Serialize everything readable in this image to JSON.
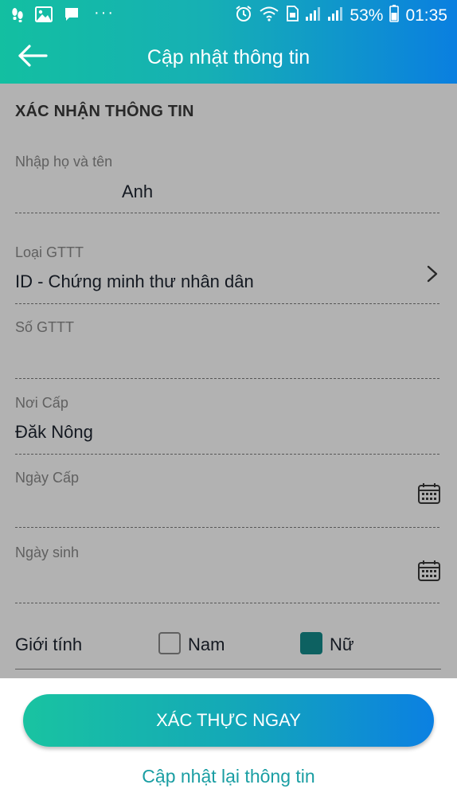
{
  "status_bar": {
    "battery_percent": "53%",
    "time": "01:35",
    "more_dots": "···"
  },
  "app_bar": {
    "title": "Cập nhật thông tin",
    "back_icon": "arrow-left-icon"
  },
  "form": {
    "section_title": "XÁC NHẬN THÔNG TIN",
    "full_name": {
      "label": "Nhập họ và tên",
      "value": "Anh"
    },
    "id_type": {
      "label": "Loại GTTT",
      "value": "ID - Chứng minh thư nhân dân"
    },
    "id_number": {
      "label": "Số GTTT",
      "value": ""
    },
    "issue_place": {
      "label": "Nơi Cấp",
      "value": "Đăk Nông"
    },
    "issue_date": {
      "label": "Ngày Cấp",
      "value": ""
    },
    "birth_date": {
      "label": "Ngày sinh",
      "value": ""
    },
    "gender": {
      "label": "Giới tính",
      "options": [
        {
          "label": "Nam",
          "checked": false
        },
        {
          "label": "Nữ",
          "checked": true
        }
      ]
    }
  },
  "actions": {
    "verify_now": "XÁC THỰC NGAY",
    "update_again": "Cập nhật lại thông tin"
  },
  "colors": {
    "gradient_start": "#13bfa1",
    "gradient_end": "#0a7fe0",
    "checked_box": "#148c8c",
    "link": "#1a9ea3"
  }
}
